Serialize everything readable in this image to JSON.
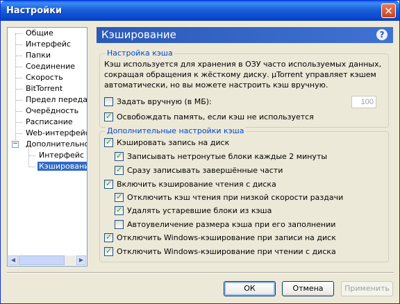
{
  "window": {
    "title": "Настройки",
    "close_glyph": "✕"
  },
  "tree": {
    "items": [
      {
        "label": "Общие"
      },
      {
        "label": "Интерфейс"
      },
      {
        "label": "Папки"
      },
      {
        "label": "Соединение"
      },
      {
        "label": "Скорость"
      },
      {
        "label": "BitTorrent"
      },
      {
        "label": "Предел передачи"
      },
      {
        "label": "Очерёдность"
      },
      {
        "label": "Расписание"
      },
      {
        "label": "Web-интерфейс"
      },
      {
        "label": "Дополнительно"
      },
      {
        "label": "Интерфейс"
      },
      {
        "label": "Кэширование"
      }
    ],
    "expand_glyph": "−",
    "scroll_left": "◀",
    "scroll_right": "▶"
  },
  "header": {
    "title": "Кэширование",
    "help": "?"
  },
  "group1": {
    "legend": "Настройка кэша",
    "description": "Кэш используется для хранения в ОЗУ часто используемых данных, сокращая обращения к жёсткому диску. µTorrent управляет кэшем автоматически, но вы можете настроить кэш вручную.",
    "manual_label": "Задать вручную (в МБ):",
    "manual_checked": false,
    "manual_value": "100",
    "free_label": "Освобождать память, если кэш не используется",
    "free_checked": true
  },
  "group2": {
    "legend": "Дополнительные настройки кэша",
    "options": [
      {
        "label": "Кэшировать запись на диск",
        "checked": true
      },
      {
        "label": "Записывать нетронутые блоки каждые 2 минуты",
        "checked": true
      },
      {
        "label": "Сразу записывать завершённые части",
        "checked": true
      },
      {
        "label": "Включить кэширование чтения с диска",
        "checked": true
      },
      {
        "label": "Отключить кэш чтения при низкой скорости раздачи",
        "checked": true
      },
      {
        "label": "Удалять устаревшие блоки из кэша",
        "checked": true
      },
      {
        "label": "Автоувеличение размера кэша при его заполнении",
        "checked": false
      },
      {
        "label": "Отключить Windows-кэширование при записи на диск",
        "checked": true
      },
      {
        "label": "Отключить Windows-кэширование при чтении с диска",
        "checked": true
      }
    ]
  },
  "buttons": {
    "ok": "ОК",
    "cancel": "Отмена",
    "apply": "Применить"
  }
}
